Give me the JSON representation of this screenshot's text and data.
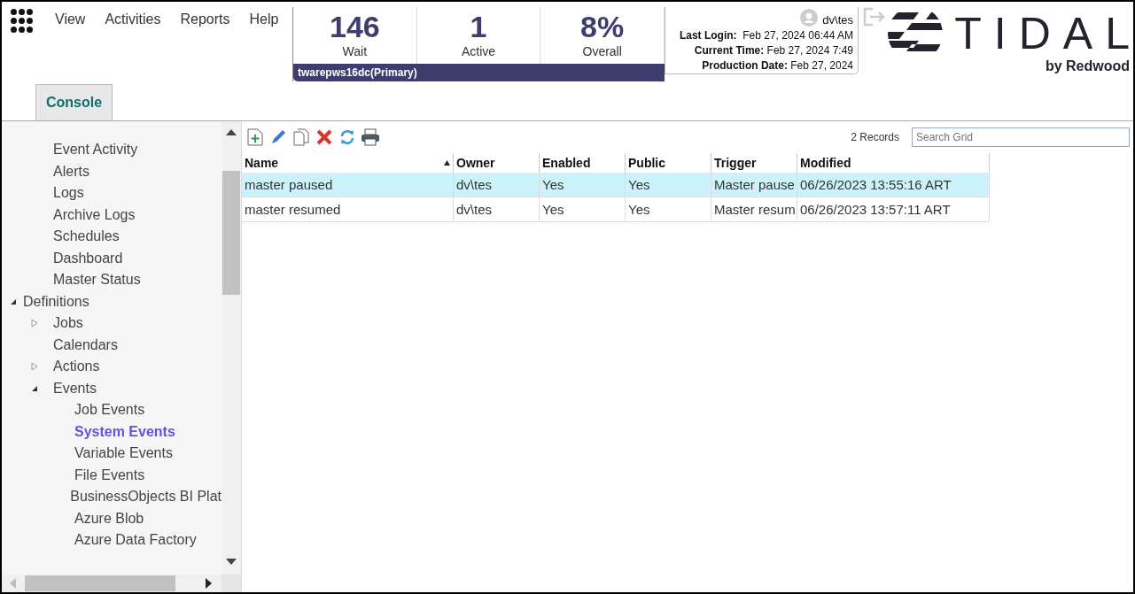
{
  "menu": [
    "View",
    "Activities",
    "Reports",
    "Help"
  ],
  "stats": [
    {
      "value": "146",
      "label": "Wait"
    },
    {
      "value": "1",
      "label": "Active"
    },
    {
      "value": "8%",
      "label": "Overall"
    }
  ],
  "master": "twarepws16dc(Primary)",
  "user": {
    "name": "dv\\tes",
    "fields": [
      {
        "label": "Last Login:",
        "value": " Feb 27, 2024 06:44 AM"
      },
      {
        "label": "Current Time:",
        "value": "Feb 27, 2024 7:49"
      },
      {
        "label": "Production Date:",
        "value": "Feb 27, 2024"
      }
    ]
  },
  "logo": {
    "name": "TIDAL",
    "tagline": "by Redwood"
  },
  "tabs": [
    {
      "label": "Console",
      "selected": true
    }
  ],
  "tree": [
    {
      "children": [
        {
          "label": "Event Activity",
          "selected": false
        },
        {
          "label": "Alerts",
          "selected": false
        },
        {
          "label": "Logs",
          "selected": false
        },
        {
          "label": "Archive Logs",
          "selected": false
        },
        {
          "label": "Schedules",
          "selected": false
        },
        {
          "label": "Dashboard",
          "selected": false
        },
        {
          "label": "Master Status",
          "selected": false
        }
      ]
    },
    {
      "label": "Definitions",
      "selected": false,
      "expanded": true,
      "children": [
        {
          "label": "Jobs",
          "selected": false,
          "expanded": false
        },
        {
          "label": "Calendars",
          "selected": false
        },
        {
          "label": "Actions",
          "selected": false,
          "expanded": false
        },
        {
          "label": "Events",
          "selected": false,
          "expanded": true,
          "children": [
            {
              "label": "Job Events",
              "selected": false
            },
            {
              "label": "System Events",
              "selected": true
            },
            {
              "label": "Variable Events",
              "selected": false
            },
            {
              "label": "File Events",
              "selected": false
            },
            {
              "label": "BusinessObjects BI Plat",
              "selected": false
            },
            {
              "label": "Azure Blob",
              "selected": false
            },
            {
              "label": "Azure Data Factory",
              "selected": false
            }
          ]
        }
      ]
    }
  ],
  "grid": {
    "records": "2 Records",
    "search_placeholder": "Search Grid",
    "columns": [
      {
        "label": "Name",
        "sorted": true
      },
      {
        "label": "Owner",
        "sorted": false
      },
      {
        "label": "Enabled",
        "sorted": false
      },
      {
        "label": "Public",
        "sorted": false
      },
      {
        "label": "Trigger",
        "sorted": false
      },
      {
        "label": "Modified",
        "sorted": false
      }
    ],
    "rows": [
      {
        "selected": true,
        "cells": [
          "master paused",
          "dv\\tes",
          "Yes",
          "Yes",
          "Master pause",
          "06/26/2023 13:55:16 ART"
        ]
      },
      {
        "selected": false,
        "cells": [
          "master resumed",
          "dv\\tes",
          "Yes",
          "Yes",
          "Master resum",
          "06/26/2023 13:57:11 ART"
        ]
      }
    ]
  }
}
